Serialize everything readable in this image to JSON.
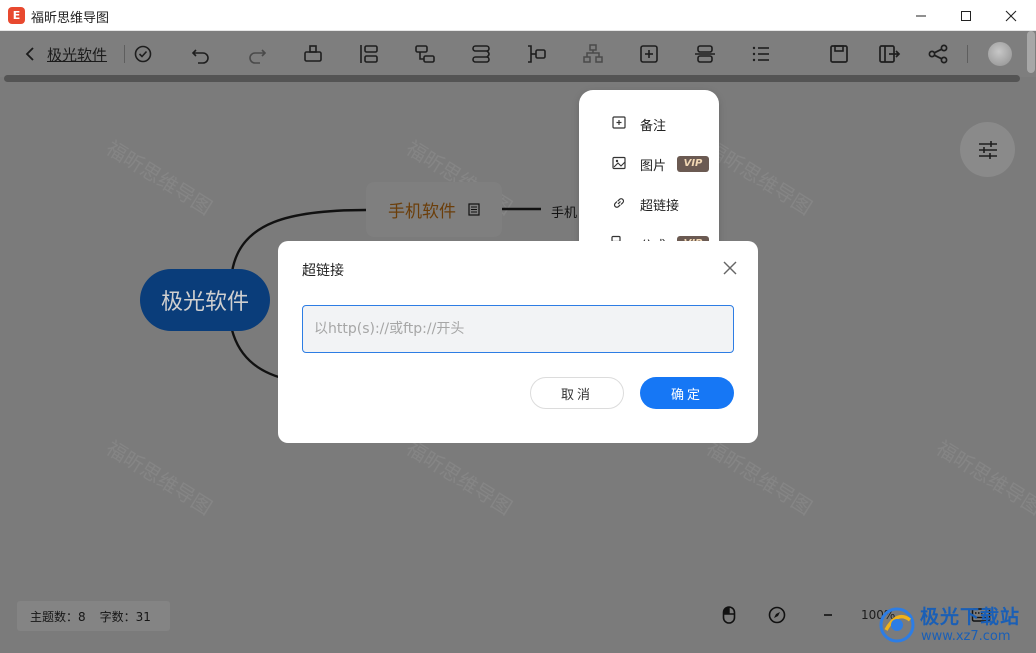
{
  "window": {
    "app_title": "福昕思维导图",
    "logo_letter": "E"
  },
  "toolbar": {
    "doc_title": "极光软件",
    "icons": [
      "saved-check-icon",
      "undo-icon",
      "redo-icon",
      "insert-parent-icon",
      "insert-sibling-icon",
      "insert-child-icon",
      "relation-line-icon",
      "summary-icon",
      "layout-icon",
      "insert-icon",
      "align-icon",
      "outline-icon",
      "save-icon",
      "export-icon",
      "share-icon"
    ]
  },
  "mindmap": {
    "root": "极光软件",
    "child": "手机软件",
    "leaf": "手机",
    "watermark_text": "福昕思维导图"
  },
  "insert_menu": {
    "items": [
      {
        "label": "备注",
        "vip": ""
      },
      {
        "label": "图片",
        "vip": "VIP"
      },
      {
        "label": "超链接",
        "vip": ""
      },
      {
        "label": "公式",
        "vip": "VIP"
      }
    ]
  },
  "dialog": {
    "title": "超链接",
    "input_value": "",
    "placeholder": "以http(s)://或ftp://开头",
    "cancel_label": "取消",
    "ok_label": "确定",
    "close_label": "X"
  },
  "status": {
    "topic_count_label": "主题数：8",
    "word_count_label": "字数：31",
    "zoom": "100%"
  },
  "site_watermark": {
    "name": "极光下载站",
    "url": "www.xz7.com"
  },
  "colors": {
    "accent": "#1677f5",
    "vip_bg": "#6b5a52",
    "root_node": "#0a3d7a"
  }
}
